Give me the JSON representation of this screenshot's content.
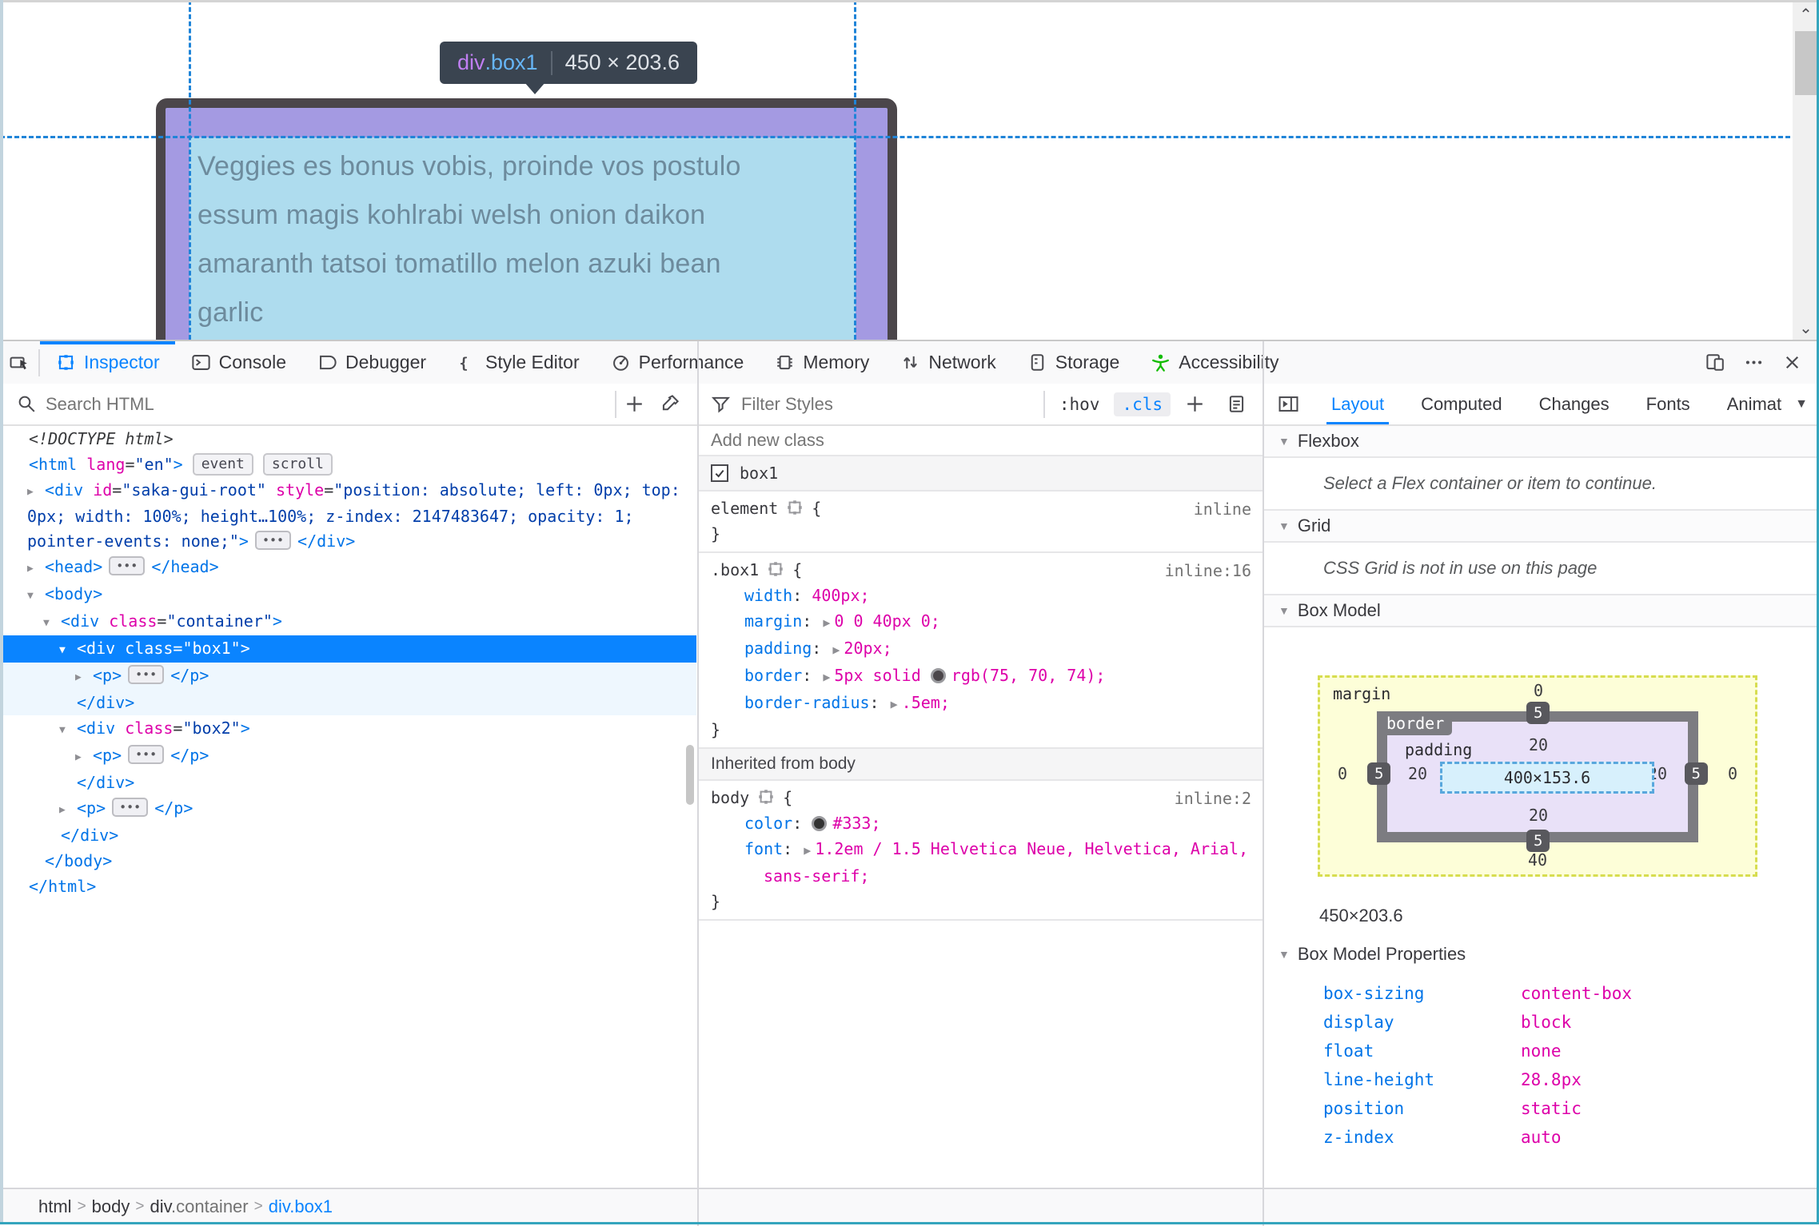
{
  "page": {
    "paragraph_lines": [
      "Veggies es bonus vobis, proinde vos postulo",
      "essum magis kohlrabi welsh onion daikon",
      "amaranth tatsoi tomatillo melon azuki bean",
      "garlic"
    ],
    "tooltip": {
      "tag": "div",
      "class": ".box1",
      "sep": "",
      "dims": "450 × 203.6"
    }
  },
  "toolbar": {
    "tabs": [
      {
        "id": "inspector",
        "label": "Inspector",
        "icon": "inspector",
        "active": true
      },
      {
        "id": "console",
        "label": "Console",
        "icon": "console"
      },
      {
        "id": "debugger",
        "label": "Debugger",
        "icon": "debugger"
      },
      {
        "id": "styleeditor",
        "label": "Style Editor",
        "icon": "braces"
      },
      {
        "id": "performance",
        "label": "Performance",
        "icon": "gauge"
      },
      {
        "id": "memory",
        "label": "Memory",
        "icon": "chip"
      },
      {
        "id": "network",
        "label": "Network",
        "icon": "updown"
      },
      {
        "id": "storage",
        "label": "Storage",
        "icon": "drive"
      },
      {
        "id": "accessibility",
        "label": "Accessibility",
        "icon": "person"
      }
    ]
  },
  "markup": {
    "search_placeholder": "Search HTML",
    "tree": [
      {
        "level": 0,
        "twisty": null,
        "lines": [
          [
            {
              "t": "doctype",
              "s": "<!DOCTYPE html>"
            }
          ]
        ]
      },
      {
        "level": 0,
        "twisty": null,
        "lines": [
          [
            {
              "t": "tag",
              "s": "<html"
            },
            {
              "t": "attr",
              "s": " lang"
            },
            {
              "t": "plain",
              "s": "="
            },
            {
              "t": "val",
              "s": "\"en\""
            },
            {
              "t": "tag",
              "s": ">"
            },
            {
              "t": "badge",
              "s": "event"
            },
            {
              "t": "badge",
              "s": "scroll"
            }
          ]
        ]
      },
      {
        "level": 1,
        "twisty": "closed",
        "lines": [
          [
            {
              "t": "tag",
              "s": "<div"
            },
            {
              "t": "attr",
              "s": " id"
            },
            {
              "t": "plain",
              "s": "="
            },
            {
              "t": "val",
              "s": "\"saka-gui-root\""
            },
            {
              "t": "attr",
              "s": " style"
            },
            {
              "t": "plain",
              "s": "="
            },
            {
              "t": "val",
              "s": "\"position: absolute; left: 0px; top:"
            }
          ],
          [
            {
              "t": "val",
              "s": "0px; width: 100%; height…100%; z-index: 2147483647; opacity: 1;"
            }
          ],
          [
            {
              "t": "val",
              "s": "pointer-events: none;\""
            },
            {
              "t": "tag",
              "s": ">"
            },
            {
              "t": "dots"
            },
            {
              "t": "tag",
              "s": "</div>"
            }
          ]
        ]
      },
      {
        "level": 1,
        "twisty": "closed",
        "lines": [
          [
            {
              "t": "tag",
              "s": "<head>"
            },
            {
              "t": "dots"
            },
            {
              "t": "tag",
              "s": "</head>"
            }
          ]
        ]
      },
      {
        "level": 1,
        "twisty": "open",
        "lines": [
          [
            {
              "t": "tag",
              "s": "<body>"
            }
          ]
        ]
      },
      {
        "level": 2,
        "twisty": "open",
        "lines": [
          [
            {
              "t": "tag",
              "s": "<div"
            },
            {
              "t": "attr",
              "s": " class"
            },
            {
              "t": "plain",
              "s": "="
            },
            {
              "t": "val",
              "s": "\"container\""
            },
            {
              "t": "tag",
              "s": ">"
            }
          ]
        ]
      },
      {
        "level": 3,
        "twisty": "open",
        "state": "selected",
        "lines": [
          [
            {
              "t": "tag",
              "s": "<div"
            },
            {
              "t": "attr",
              "s": " class"
            },
            {
              "t": "plain",
              "s": "="
            },
            {
              "t": "val",
              "s": "\"box1\""
            },
            {
              "t": "tag",
              "s": ">"
            }
          ]
        ]
      },
      {
        "level": 4,
        "twisty": "closed",
        "state": "childsel",
        "lines": [
          [
            {
              "t": "tag",
              "s": "<p>"
            },
            {
              "t": "dots"
            },
            {
              "t": "tag",
              "s": "</p>"
            }
          ]
        ]
      },
      {
        "level": 3,
        "twisty": null,
        "state": "childsel",
        "closing": true,
        "lines": [
          [
            {
              "t": "tag",
              "s": "</div>"
            }
          ]
        ]
      },
      {
        "level": 3,
        "twisty": "open",
        "lines": [
          [
            {
              "t": "tag",
              "s": "<div"
            },
            {
              "t": "attr",
              "s": " class"
            },
            {
              "t": "plain",
              "s": "="
            },
            {
              "t": "val",
              "s": "\"box2\""
            },
            {
              "t": "tag",
              "s": ">"
            }
          ]
        ]
      },
      {
        "level": 4,
        "twisty": "closed",
        "lines": [
          [
            {
              "t": "tag",
              "s": "<p>"
            },
            {
              "t": "dots"
            },
            {
              "t": "tag",
              "s": "</p>"
            }
          ]
        ]
      },
      {
        "level": 3,
        "twisty": null,
        "closing": true,
        "lines": [
          [
            {
              "t": "tag",
              "s": "</div>"
            }
          ]
        ]
      },
      {
        "level": 3,
        "twisty": "closed",
        "lines": [
          [
            {
              "t": "tag",
              "s": "<p>"
            },
            {
              "t": "dots"
            },
            {
              "t": "tag",
              "s": "</p>"
            }
          ]
        ]
      },
      {
        "level": 2,
        "twisty": null,
        "closing": true,
        "lines": [
          [
            {
              "t": "tag",
              "s": "</div>"
            }
          ]
        ]
      },
      {
        "level": 1,
        "twisty": null,
        "closing": true,
        "lines": [
          [
            {
              "t": "tag",
              "s": "</body>"
            }
          ]
        ]
      },
      {
        "level": 0,
        "twisty": null,
        "closing": true,
        "lines": [
          [
            {
              "t": "tag",
              "s": "</html>"
            }
          ]
        ]
      }
    ],
    "breadcrumb": [
      {
        "text": "html"
      },
      {
        "text": "body"
      },
      {
        "text": "div",
        "dim": ".container"
      },
      {
        "text": "div.box1",
        "active": true
      }
    ]
  },
  "rules": {
    "filter_placeholder": "Filter Styles",
    "hov_label": ":hov",
    "cls_label": ".cls",
    "add_class_placeholder": "Add new class",
    "class_toggle_label": "box1",
    "rules_list": [
      {
        "selector": "element",
        "loc": "inline",
        "props": []
      },
      {
        "selector": ".box1",
        "loc": "inline:16",
        "props": [
          {
            "name": "width",
            "parts": [
              {
                "s": "400px"
              }
            ]
          },
          {
            "name": "margin",
            "arrow": true,
            "parts": [
              {
                "s": "0 0 40px 0"
              }
            ]
          },
          {
            "name": "padding",
            "arrow": true,
            "parts": [
              {
                "s": "20px"
              }
            ]
          },
          {
            "name": "border",
            "arrow": true,
            "parts": [
              {
                "s": "5px solid "
              },
              {
                "swatch": "#4b464a"
              },
              {
                "s": "rgb(75, 70, 74)"
              }
            ]
          },
          {
            "name": "border-radius",
            "arrow": true,
            "parts": [
              {
                "s": ".5em"
              }
            ]
          }
        ]
      },
      {
        "header": "Inherited from body"
      },
      {
        "selector": "body",
        "loc": "inline:2",
        "props": [
          {
            "name": "color",
            "parts": [
              {
                "swatch": "#333333"
              },
              {
                "s": "#333"
              }
            ]
          },
          {
            "name": "font",
            "arrow": true,
            "parts": [
              {
                "s": "1.2em / 1.5 Helvetica Neue, Helvetica, Arial,"
              },
              {
                "br": true
              },
              {
                "s": "sans-serif"
              }
            ]
          }
        ]
      }
    ]
  },
  "layout_panel": {
    "tabs": [
      {
        "label": "Layout",
        "active": true
      },
      {
        "label": "Computed"
      },
      {
        "label": "Changes"
      },
      {
        "label": "Fonts"
      },
      {
        "label": "Animations"
      }
    ],
    "flexbox_header": "Flexbox",
    "flexbox_msg": "Select a Flex container or item to continue.",
    "grid_header": "Grid",
    "grid_msg": "CSS Grid is not in use on this page",
    "boxmodel_header": "Box Model",
    "box_model": {
      "margin_label": "margin",
      "border_label": "border",
      "padding_label": "padding",
      "margin": {
        "top": "0",
        "right": "0",
        "bottom": "40",
        "left": "0"
      },
      "border": {
        "top": "5",
        "right": "5",
        "bottom": "5",
        "left": "5"
      },
      "padding": {
        "top": "20",
        "right": "20",
        "bottom": "20",
        "left": "20"
      },
      "content": "400×153.6",
      "dims": "450×203.6",
      "position": "static"
    },
    "properties_header": "Box Model Properties",
    "properties": [
      {
        "name": "box-sizing",
        "value": "content-box"
      },
      {
        "name": "display",
        "value": "block"
      },
      {
        "name": "float",
        "value": "none"
      },
      {
        "name": "line-height",
        "value": "28.8px"
      },
      {
        "name": "position",
        "value": "static"
      },
      {
        "name": "z-index",
        "value": "auto"
      }
    ]
  },
  "colors": {
    "accent": "#0a84ff",
    "tag_blue": "#0074e8",
    "attr_magenta": "#dd00a9",
    "value_navy": "#003eaa",
    "highlight_purple": "#a49ae2",
    "highlight_blue": "#aedcee",
    "border_dark": "#4b464a",
    "accessibility_green": "#12bc00"
  }
}
